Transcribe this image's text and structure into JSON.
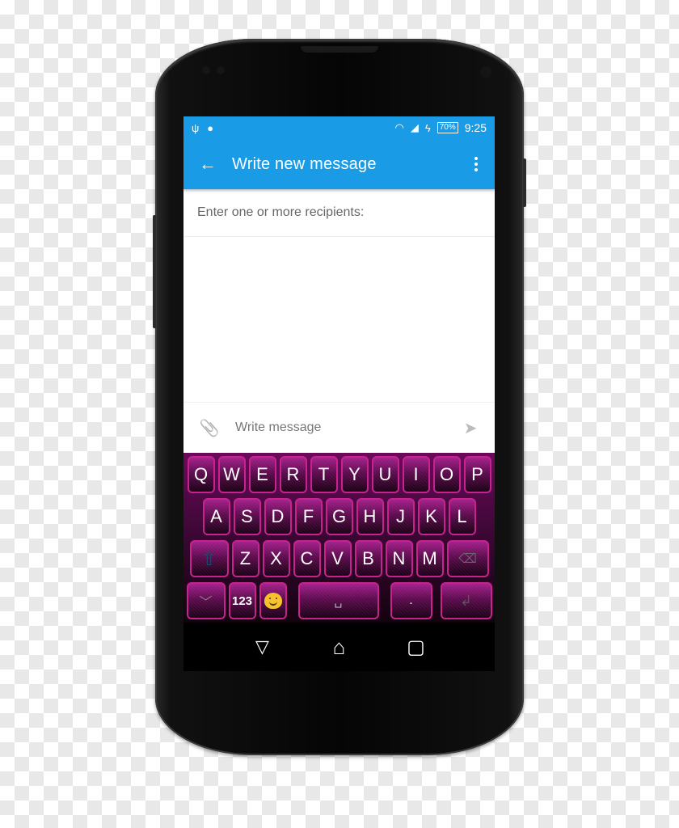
{
  "status_bar": {
    "left_icons": [
      "usb-icon",
      "android-icon"
    ],
    "right_icons": [
      "wifi-icon",
      "signal-icon",
      "charging-icon"
    ],
    "battery": "70%",
    "time": "9:25"
  },
  "app_bar": {
    "back_icon": "arrow-left-icon",
    "back_glyph": "←",
    "title": "Write new message",
    "menu_icon": "more-vert-icon"
  },
  "recipients": {
    "placeholder": "Enter one or more recipients:"
  },
  "compose": {
    "attach_icon": "paperclip-icon",
    "attach_glyph": "📎",
    "placeholder": "Write message",
    "send_icon": "send-icon",
    "send_glyph": "➤"
  },
  "keyboard": {
    "row1": [
      "Q",
      "W",
      "E",
      "R",
      "T",
      "Y",
      "U",
      "I",
      "O",
      "P"
    ],
    "row2": [
      "A",
      "S",
      "D",
      "F",
      "G",
      "H",
      "J",
      "K",
      "L"
    ],
    "row3": [
      "Z",
      "X",
      "C",
      "V",
      "B",
      "N",
      "M"
    ],
    "shift_glyph": "⇧",
    "backspace_glyph": "⌫",
    "hide_glyph": "﹀",
    "numbers_label": "123",
    "space_glyph": "␣",
    "period_label": ".",
    "enter_glyph": "↲",
    "accent_color": "#c8228f"
  },
  "nav_bar": {
    "back_glyph": "▽",
    "home_glyph": "⌂",
    "recents_glyph": "▢"
  },
  "colors": {
    "app_bar": "#1a9be6",
    "keyboard_border": "#c8228f"
  }
}
